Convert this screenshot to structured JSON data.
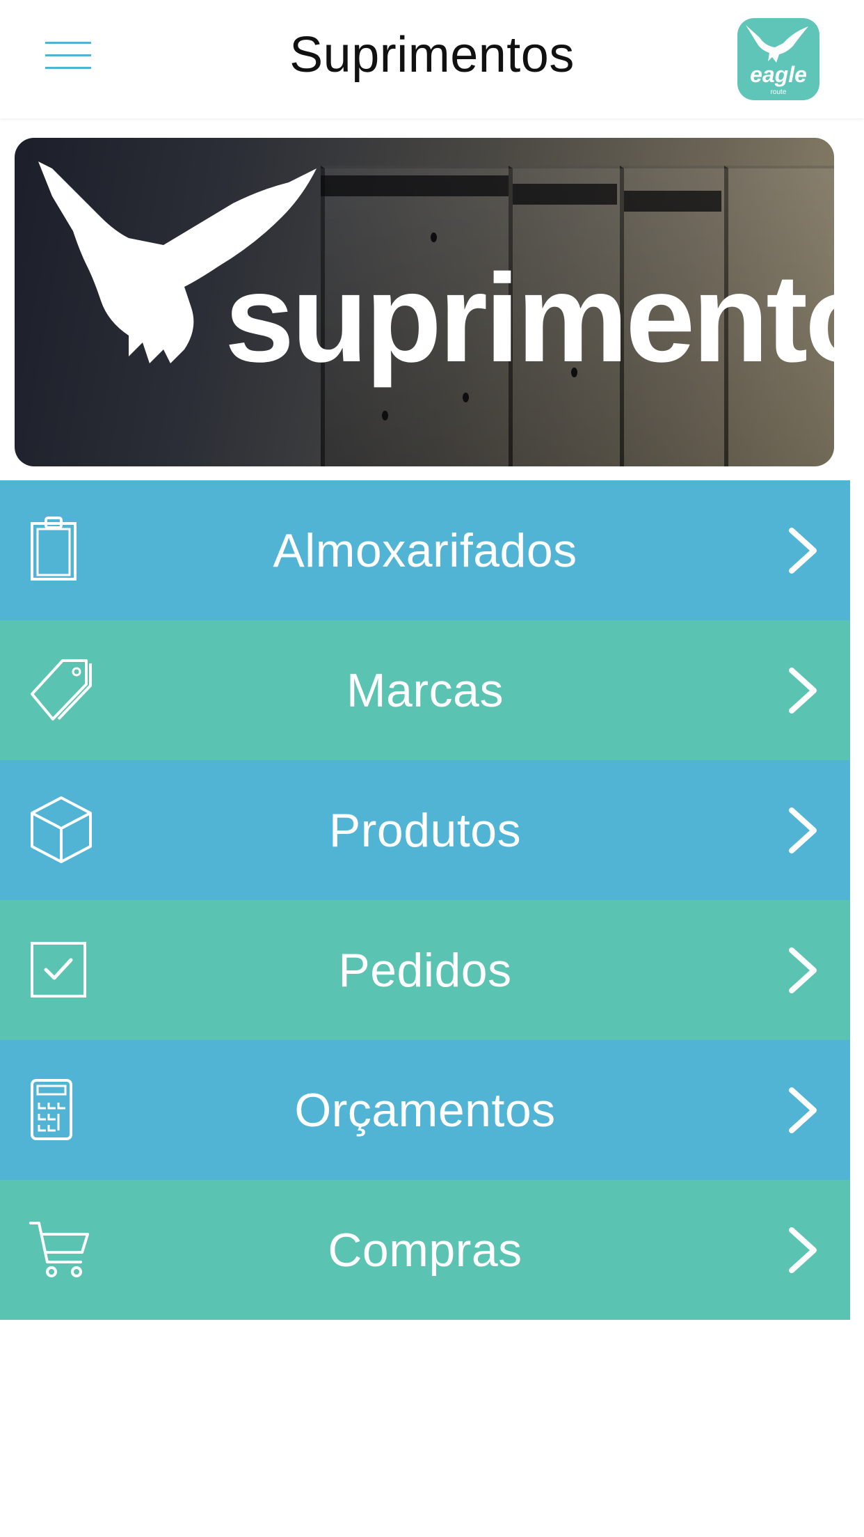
{
  "header": {
    "title": "Suprimentos",
    "logo_text": "eagle",
    "logo_subtext": "route"
  },
  "banner": {
    "text": "suprimentos"
  },
  "menu": {
    "items": [
      {
        "label": "Almoxarifados",
        "icon": "clipboard-icon",
        "color": "#51b4d4"
      },
      {
        "label": "Marcas",
        "icon": "tag-icon",
        "color": "#5bc3b2"
      },
      {
        "label": "Produtos",
        "icon": "box-icon",
        "color": "#51b4d4"
      },
      {
        "label": "Pedidos",
        "icon": "checkbox-icon",
        "color": "#5bc3b2"
      },
      {
        "label": "Orçamentos",
        "icon": "calculator-icon",
        "color": "#51b4d4"
      },
      {
        "label": "Compras",
        "icon": "cart-icon",
        "color": "#5bc3b2"
      }
    ]
  },
  "colors": {
    "accent_blue": "#51b4d4",
    "accent_green": "#5bc3b2",
    "logo_bg": "#5ec5b8"
  }
}
